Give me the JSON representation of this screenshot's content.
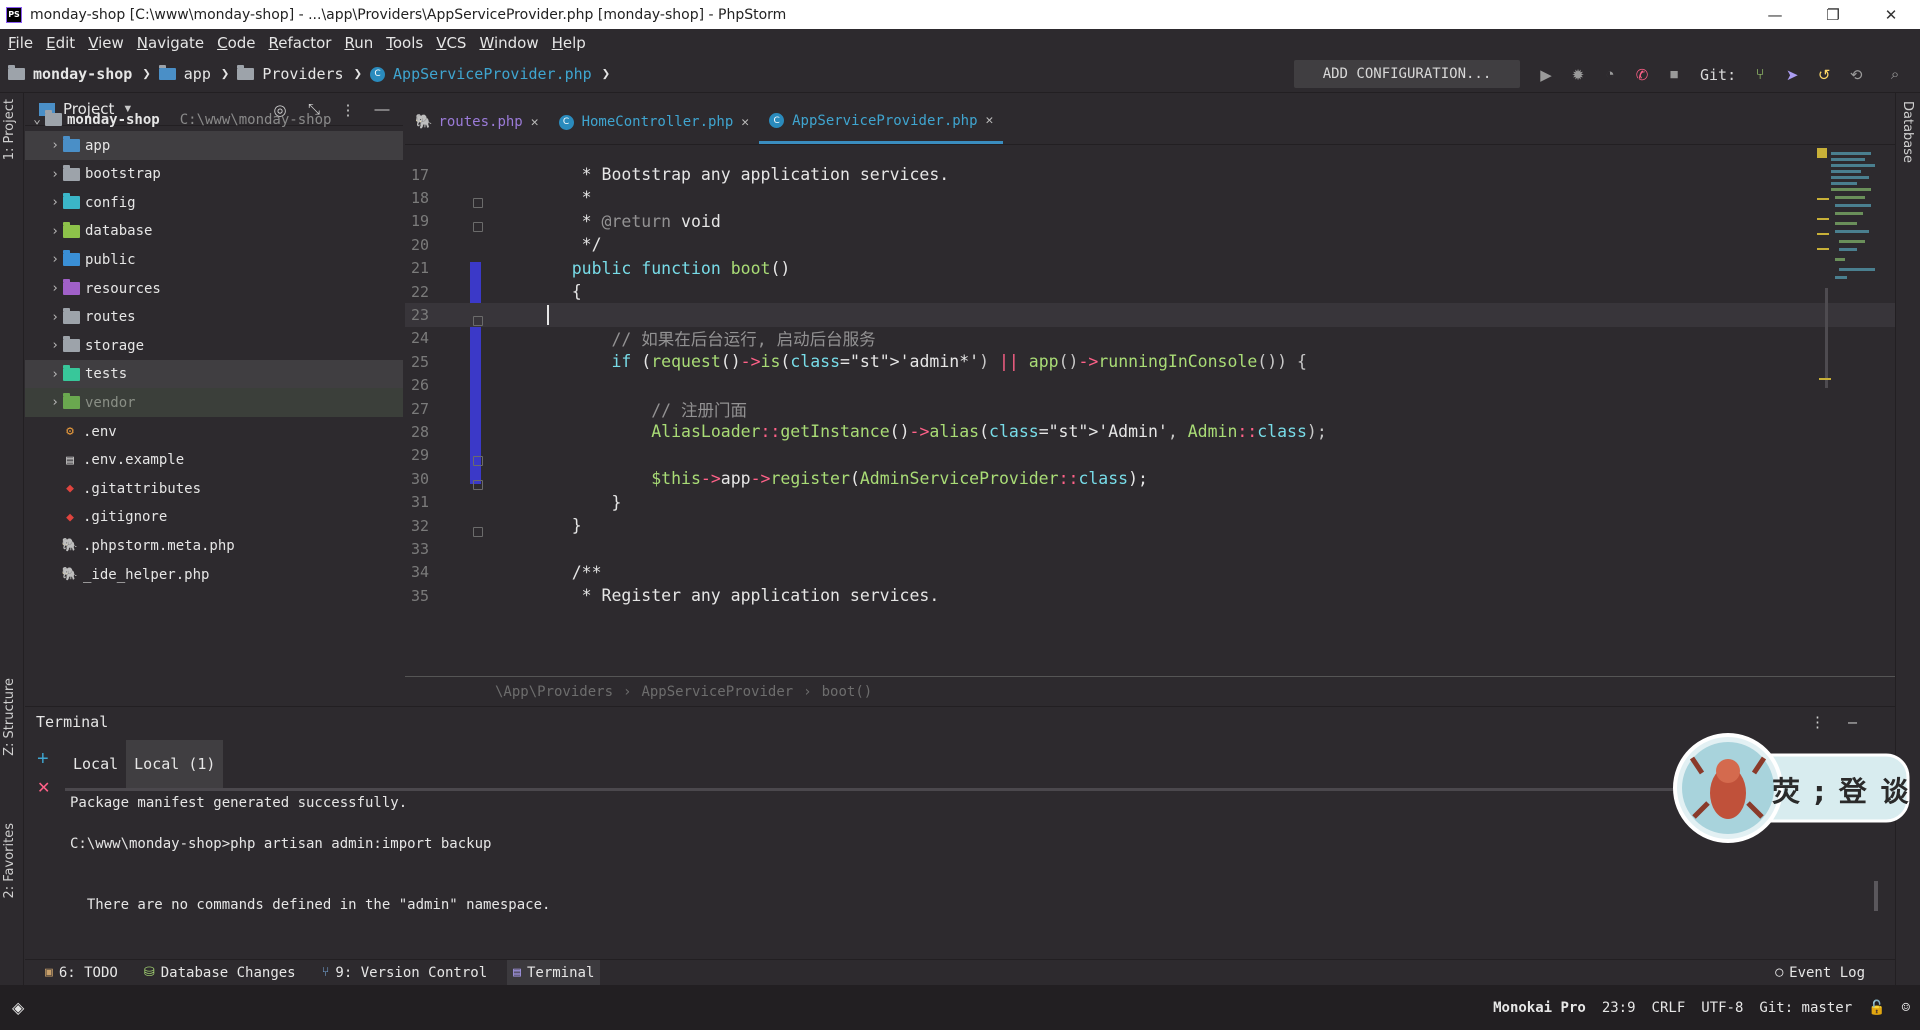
{
  "window": {
    "title": "monday-shop [C:\\www\\monday-shop] - ...\\app\\Providers\\AppServiceProvider.php [monday-shop] - PhpStorm",
    "logo_text": "PS",
    "minimize": "—",
    "restore": "❐",
    "close": "✕"
  },
  "menu": [
    "File",
    "Edit",
    "View",
    "Navigate",
    "Code",
    "Refactor",
    "Run",
    "Tools",
    "VCS",
    "Window",
    "Help"
  ],
  "navbar": {
    "crumb_project": "monday-shop",
    "crumb_app": "app",
    "crumb_providers": "Providers",
    "crumb_file": "AppServiceProvider.php",
    "add_configuration": "ADD CONFIGURATION...",
    "git_label": "Git:"
  },
  "left_strip": {
    "project_tab": "1: Project",
    "structure_tab": "Z: Structure",
    "favorites_tab": "2: Favorites"
  },
  "right_strip": {
    "database_tab": "Database"
  },
  "project_panel": {
    "title": "Project",
    "root_name": "monday-shop",
    "root_path": "C:\\www\\monday-shop",
    "items": [
      {
        "name": "app",
        "kind": "folder",
        "color": "#4a8fc7"
      },
      {
        "name": "bootstrap",
        "kind": "folder",
        "color": "#9da3aa"
      },
      {
        "name": "config",
        "kind": "folder",
        "color": "#3bb6c8"
      },
      {
        "name": "database",
        "kind": "folder",
        "color": "#8dc24a"
      },
      {
        "name": "public",
        "kind": "folder",
        "color": "#3a8fd6"
      },
      {
        "name": "resources",
        "kind": "folder",
        "color": "#a060c8"
      },
      {
        "name": "routes",
        "kind": "folder",
        "color": "#9da3aa"
      },
      {
        "name": "storage",
        "kind": "folder",
        "color": "#9da3aa"
      },
      {
        "name": "tests",
        "kind": "folder",
        "color": "#38c79a"
      },
      {
        "name": "vendor",
        "kind": "folder",
        "color": "#6aa84f"
      },
      {
        "name": ".env",
        "kind": "file",
        "icon": "env-icon"
      },
      {
        "name": ".env.example",
        "kind": "file",
        "icon": "text-file-icon"
      },
      {
        "name": ".gitattributes",
        "kind": "file",
        "icon": "git-icon"
      },
      {
        "name": ".gitignore",
        "kind": "file",
        "icon": "git-icon"
      },
      {
        "name": ".phpstorm.meta.php",
        "kind": "file",
        "icon": "php-icon"
      },
      {
        "name": "_ide_helper.php",
        "kind": "file",
        "icon": "php-icon"
      }
    ]
  },
  "tabs": [
    {
      "label": "routes.php",
      "icon": "php-elephant-icon",
      "active": false
    },
    {
      "label": "HomeController.php",
      "icon": "class-icon",
      "active": false
    },
    {
      "label": "AppServiceProvider.php",
      "icon": "class-icon",
      "active": true
    }
  ],
  "editor": {
    "lines": [
      {
        "n": "17",
        "code": "     * Bootstrap any application services."
      },
      {
        "n": "18",
        "code": "     *"
      },
      {
        "n": "19",
        "code": "     * @return void"
      },
      {
        "n": "20",
        "code": "     */"
      },
      {
        "n": "21",
        "code": "    public function boot()"
      },
      {
        "n": "22",
        "code": "    {"
      },
      {
        "n": "23",
        "code": ""
      },
      {
        "n": "24",
        "code": "        // 如果在后台运行, 启动后台服务"
      },
      {
        "n": "25",
        "code": "        if (request()->is('admin*') || app()->runningInConsole()) {"
      },
      {
        "n": "26",
        "code": ""
      },
      {
        "n": "27",
        "code": "            // 注册门面"
      },
      {
        "n": "28",
        "code": "            AliasLoader::getInstance()->alias('Admin', Admin::class);"
      },
      {
        "n": "29",
        "code": ""
      },
      {
        "n": "30",
        "code": "            $this->app->register(AdminServiceProvider::class);"
      },
      {
        "n": "31",
        "code": "        }"
      },
      {
        "n": "32",
        "code": "    }"
      },
      {
        "n": "33",
        "code": ""
      },
      {
        "n": "34",
        "code": "    /**"
      },
      {
        "n": "35",
        "code": "     * Register any application services."
      }
    ],
    "breadcrumb": [
      "\\App\\Providers",
      "AppServiceProvider",
      "boot()"
    ]
  },
  "terminal": {
    "title": "Terminal",
    "tabs": [
      "Local",
      "Local (1)"
    ],
    "lines": [
      "Package manifest generated successfully.",
      "C:\\www\\monday-shop>php artisan admin:import backup",
      "  There are no commands defined in the \"admin\" namespace."
    ]
  },
  "toolwindows": [
    {
      "label": "6: TODO",
      "icon": "todo-icon"
    },
    {
      "label": "Database Changes",
      "icon": "database-icon"
    },
    {
      "label": "9: Version Control",
      "icon": "vcs-icon"
    },
    {
      "label": "Terminal",
      "icon": "terminal-icon"
    }
  ],
  "event_log": "Event Log",
  "status": {
    "theme": "Monokai Pro",
    "position": "23:9",
    "line_sep": "CRLF",
    "encoding": "UTF-8",
    "git_branch": "Git: master"
  },
  "badge": {
    "text": "荧 ; 登 谈"
  },
  "colors": {
    "background": "#2d2a2e",
    "accent": "#3a8dbf",
    "string": "#ffd866",
    "keyword": "#78dce8",
    "function": "#a9dc76",
    "modified_gutter": "#3b39c8"
  }
}
